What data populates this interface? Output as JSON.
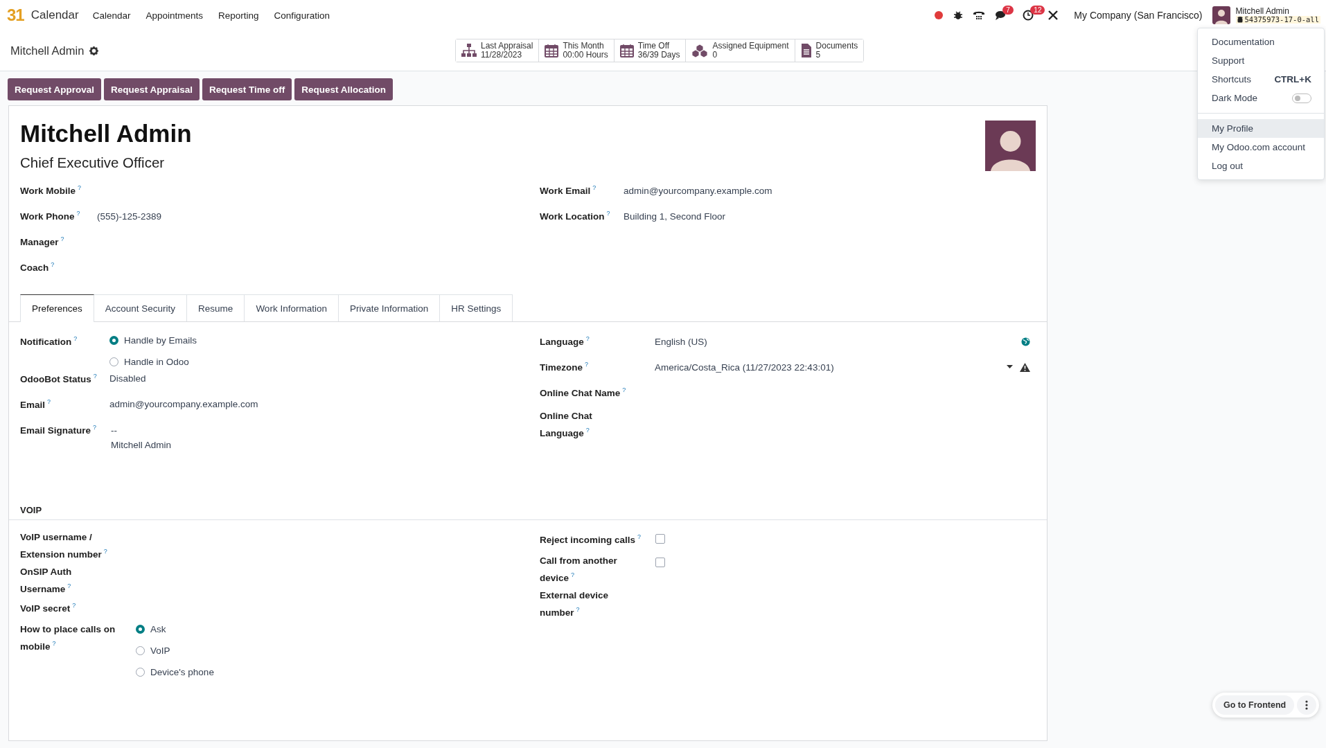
{
  "navbar": {
    "logo": "31",
    "app_name": "Calendar",
    "menu": [
      "Calendar",
      "Appointments",
      "Reporting",
      "Configuration"
    ],
    "chat_badge": "7",
    "activity_badge": "12",
    "company": "My Company (San Francisco)",
    "user_name": "Mitchell Admin",
    "database": "54375973-17-0-all"
  },
  "breadcrumb": "Mitchell Admin",
  "stat_buttons": [
    {
      "kind": "org",
      "label": "Last Appraisal",
      "value": "11/28/2023"
    },
    {
      "kind": "calendar",
      "label": "This Month",
      "value": "00:00 Hours"
    },
    {
      "kind": "calendar",
      "label": "Time Off",
      "value": "36/39 Days"
    },
    {
      "kind": "cubes",
      "label": "Assigned Equipment",
      "value": "0"
    },
    {
      "kind": "document",
      "label": "Documents",
      "value": "5"
    }
  ],
  "action_buttons": [
    "Request Approval",
    "Request Appraisal",
    "Request Time off",
    "Request Allocation"
  ],
  "employee": {
    "name": "Mitchell Admin",
    "job_title": "Chief Executive Officer",
    "left_fields": [
      {
        "label": "Work Mobile",
        "help": "?"
      },
      {
        "label": "Work Phone",
        "help": "?",
        "value": "(555)-125-2389"
      },
      {
        "label": "Manager",
        "help": "?"
      },
      {
        "label": "Coach",
        "help": "?"
      }
    ],
    "right_fields": [
      {
        "label": "Work Email",
        "help": "?",
        "value": "admin@yourcompany.example.com"
      },
      {
        "label": "Work Location",
        "help": "?",
        "value": "Building 1, Second Floor"
      }
    ]
  },
  "tabs": [
    {
      "label": "Preferences",
      "selected": true
    },
    {
      "label": "Account Security",
      "selected": false
    },
    {
      "label": "Resume",
      "selected": false
    },
    {
      "label": "Work Information",
      "selected": false
    },
    {
      "label": "Private Information",
      "selected": false
    },
    {
      "label": "HR Settings",
      "selected": false
    }
  ],
  "preferences": {
    "left": [
      {
        "kind": "radio",
        "label": "Notification",
        "help": "?",
        "options": [
          {
            "label": "Handle by Emails",
            "selected": true
          },
          {
            "label": "Handle in Odoo",
            "selected": false
          }
        ]
      },
      {
        "kind": "text",
        "label": "OdooBot Status",
        "help": "?",
        "value": "Disabled"
      },
      {
        "kind": "text",
        "label": "Email",
        "help": "?",
        "value": "admin@yourcompany.example.com"
      },
      {
        "kind": "lines",
        "label": "Email Signature",
        "help": "?",
        "lines": [
          "--",
          "Mitchell Admin"
        ]
      }
    ],
    "right": [
      {
        "kind": "text",
        "label": "Language",
        "help": "?",
        "value": "English (US)",
        "suffix": {
          "kind": "globe"
        }
      },
      {
        "kind": "text",
        "label": "Timezone",
        "help": "?",
        "value": "America/Costa_Rica (11/27/2023 22:43:01)",
        "suffix": {
          "kind": "dropdown-warning"
        }
      },
      {
        "kind": "text",
        "label": "Online Chat Name",
        "help": "?"
      },
      {
        "kind": "text",
        "label": "Online Chat Language",
        "help": "?"
      }
    ]
  },
  "voip": {
    "title": "VOIP",
    "left": [
      {
        "kind": "text",
        "label": "VoIP username / Extension number",
        "help": "?"
      },
      {
        "kind": "text",
        "label": "OnSIP Auth Username",
        "help": "?"
      },
      {
        "kind": "text",
        "label": "VoIP secret",
        "help": "?"
      },
      {
        "kind": "radio",
        "label": "How to place calls on mobile",
        "help": "?",
        "options": [
          {
            "label": "Ask",
            "selected": true
          },
          {
            "label": "VoIP",
            "selected": false
          },
          {
            "label": "Device's phone",
            "selected": false
          }
        ]
      }
    ],
    "right": [
      {
        "kind": "checkbox",
        "label": "Reject incoming calls",
        "help": "?",
        "checked": false
      },
      {
        "kind": "checkbox",
        "label": "Call from another device",
        "help": "?",
        "checked": false
      },
      {
        "kind": "text",
        "label": "External device number",
        "help": "?"
      }
    ]
  },
  "user_menu": [
    {
      "kind": "link",
      "label": "Documentation",
      "selected": false
    },
    {
      "kind": "link",
      "label": "Support",
      "selected": false
    },
    {
      "kind": "shortcut",
      "label": "Shortcuts",
      "shortcut": "CTRL+K",
      "selected": false
    },
    {
      "kind": "toggle",
      "label": "Dark Mode",
      "on": false,
      "selected": false
    },
    {
      "kind": "divider"
    },
    {
      "kind": "link",
      "label": "My Profile",
      "selected": true
    },
    {
      "kind": "link",
      "label": "My Odoo.com account",
      "selected": false
    },
    {
      "kind": "link",
      "label": "Log out",
      "selected": false
    }
  ],
  "floating_button": "Go to Frontend"
}
